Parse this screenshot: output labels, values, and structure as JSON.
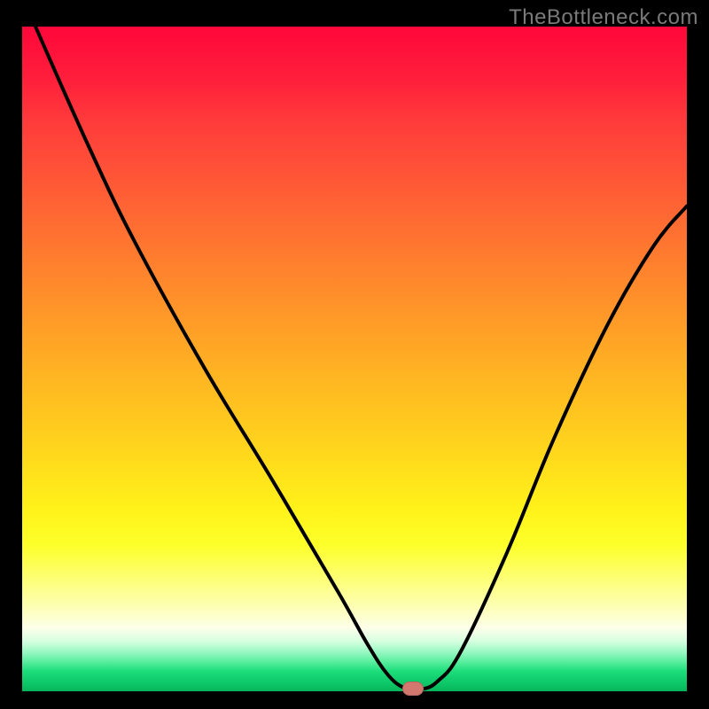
{
  "watermark": "TheBottleneck.com",
  "chart_data": {
    "type": "line",
    "title": "",
    "xlabel": "",
    "ylabel": "",
    "xlim": [
      0,
      100
    ],
    "ylim": [
      0,
      100
    ],
    "grid": false,
    "legend": false,
    "background_gradient": {
      "top_color": "#ff073a",
      "bottom_color": "#06b45a",
      "description": "vertical red-to-green gradient through orange/yellow"
    },
    "series": [
      {
        "name": "bottleneck_curve",
        "x": [
          2,
          10,
          17,
          27.5,
          37.5,
          47.5,
          52,
          55,
          57.5,
          60,
          62.5,
          66,
          73,
          80,
          88,
          95,
          100
        ],
        "values": [
          100,
          82,
          67.5,
          48.5,
          32,
          15,
          7,
          2.5,
          0.5,
          0.3,
          1.5,
          6,
          21,
          38,
          55,
          67,
          73
        ],
        "color": "#000000"
      }
    ],
    "marker": {
      "x": 58.8,
      "y": 0.4,
      "color": "#d3786f",
      "shape": "pill"
    }
  }
}
